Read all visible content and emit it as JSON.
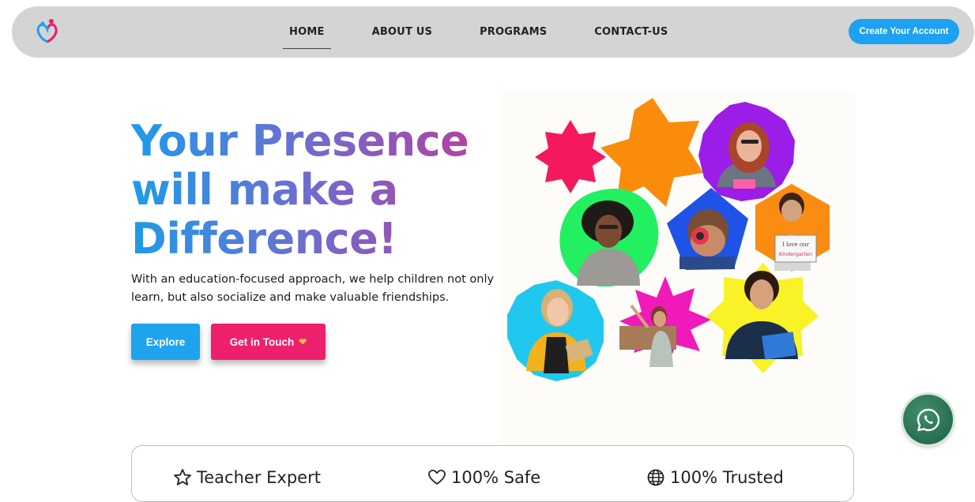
{
  "nav": {
    "items": [
      {
        "label": "HOME",
        "active": true
      },
      {
        "label": "ABOUT US",
        "active": false
      },
      {
        "label": "PROGRAMS",
        "active": false
      },
      {
        "label": "CONTACT-US",
        "active": false
      }
    ],
    "cta_label": "Create Your Account"
  },
  "hero": {
    "title_lines": [
      "Your Presence",
      "will make a",
      "Difference!"
    ],
    "subtitle": "With an education-focused approach, we help children not only learn, but also socialize and make valuable friendships.",
    "explore_label": "Explore",
    "touch_label": "Get in Touch",
    "collage_text": {
      "sign": "I love our",
      "sign2": "Kindergarten"
    }
  },
  "features": [
    {
      "icon": "star-icon",
      "label": "Teacher Expert"
    },
    {
      "icon": "heart-icon",
      "label": "100% Safe"
    },
    {
      "icon": "globe-icon",
      "label": "100% Trusted"
    }
  ],
  "colors": {
    "brand_blue": "#1da1f2",
    "brand_pink": "#ee1f6c",
    "nav_bg": "#d4d4d4",
    "whatsapp": "#2b7553"
  }
}
